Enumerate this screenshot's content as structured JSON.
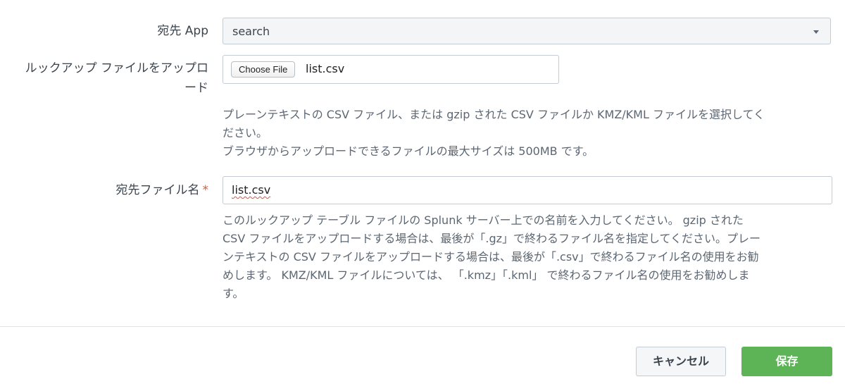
{
  "dest_app": {
    "label": "宛先 App",
    "selected": "search"
  },
  "upload": {
    "label_line1": "ルックアップ ファイルをアップロ",
    "label_line2": "ード",
    "choose_button": "Choose File",
    "file_name": "list.csv",
    "help_line1": "プレーンテキストの CSV ファイル、または gzip された CSV ファイルか KMZ/KML ファイルを選択してく",
    "help_line2": "ださい。",
    "help_line3": "ブラウザからアップロードできるファイルの最大サイズは 500MB です。"
  },
  "dest_file": {
    "label": "宛先ファイル名",
    "required_mark": "*",
    "value": "list.csv",
    "help_line1": "このルックアップ テーブル ファイルの Splunk サーバー上での名前を入力してください。 gzip された",
    "help_line2": "CSV ファイルをアップロードする場合は、最後が「.gz」で終わるファイル名を指定してください。プレー",
    "help_line3": "ンテキストの CSV ファイルをアップロードする場合は、最後が「.csv」で終わるファイル名の使用をお勧",
    "help_line4": "めします。 KMZ/KML ファイルについては、 「.kmz」「.kml」 で終わるファイル名の使用をお勧めしま",
    "help_line5": "す。"
  },
  "footer": {
    "cancel_label": "キャンセル",
    "save_label": "保存",
    "save_color": "#5cb456"
  }
}
